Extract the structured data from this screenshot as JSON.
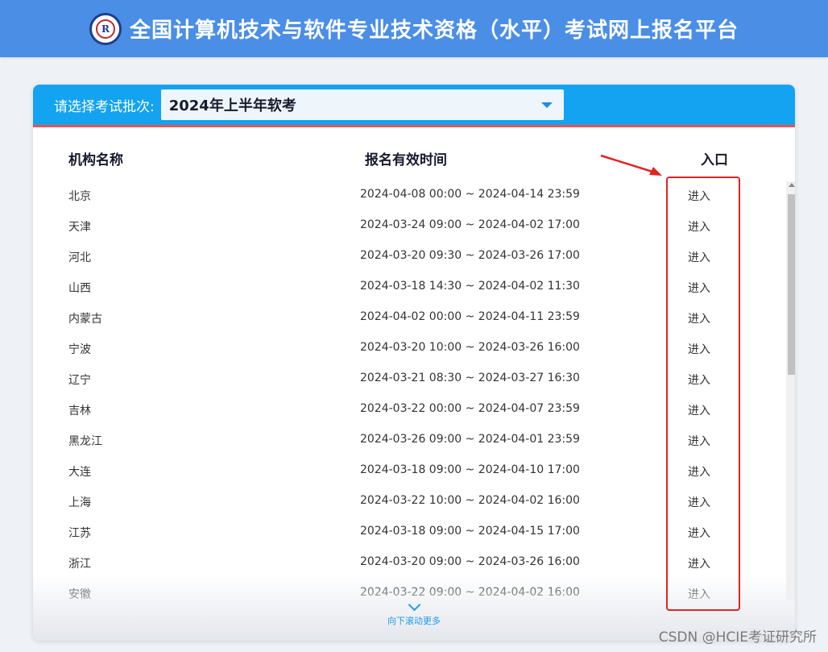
{
  "header": {
    "title": "全国计算机技术与软件专业技术资格（水平）考试网上报名平台",
    "logo_text": "R"
  },
  "batch": {
    "label": "请选择考试批次:",
    "value": "2024年上半年软考"
  },
  "table": {
    "columns": [
      "机构名称",
      "报名有效时间",
      "入口"
    ],
    "rows": [
      {
        "name": "北京",
        "time": "2024-04-08 00:00 ~ 2024-04-14 23:59",
        "entry": "进入"
      },
      {
        "name": "天津",
        "time": "2024-03-24 09:00 ~ 2024-04-02 17:00",
        "entry": "进入"
      },
      {
        "name": "河北",
        "time": "2024-03-20 09:30 ~ 2024-03-26 17:00",
        "entry": "进入"
      },
      {
        "name": "山西",
        "time": "2024-03-18 14:30 ~ 2024-04-02 11:30",
        "entry": "进入"
      },
      {
        "name": "内蒙古",
        "time": "2024-04-02 00:00 ~ 2024-04-11 23:59",
        "entry": "进入"
      },
      {
        "name": "宁波",
        "time": "2024-03-20 10:00 ~ 2024-03-26 16:00",
        "entry": "进入"
      },
      {
        "name": "辽宁",
        "time": "2024-03-21 08:30 ~ 2024-03-27 16:30",
        "entry": "进入"
      },
      {
        "name": "吉林",
        "time": "2024-03-22 00:00 ~ 2024-04-07 23:59",
        "entry": "进入"
      },
      {
        "name": "黑龙江",
        "time": "2024-03-26 09:00 ~ 2024-04-01 23:59",
        "entry": "进入"
      },
      {
        "name": "大连",
        "time": "2024-03-18 09:00 ~ 2024-04-10 17:00",
        "entry": "进入"
      },
      {
        "name": "上海",
        "time": "2024-03-22 10:00 ~ 2024-04-02 16:00",
        "entry": "进入"
      },
      {
        "name": "江苏",
        "time": "2024-03-18 09:00 ~ 2024-04-15 17:00",
        "entry": "进入"
      },
      {
        "name": "浙江",
        "time": "2024-03-20 09:00 ~ 2024-03-26 16:00",
        "entry": "进入"
      },
      {
        "name": "安徽",
        "time": "2024-03-22 09:00 ~ 2024-04-02 16:00",
        "entry": "进入"
      }
    ]
  },
  "scroll_more": {
    "label": "向下滚动更多",
    "icon": "chevron-down-icon"
  },
  "watermark": "CSDN @HCIE考证研究所",
  "colors": {
    "header": "#4a8ee6",
    "card_head": "#13a3f0",
    "accent_line": "#e9554f",
    "annotation": "#e02424",
    "link": "#1f9ce8"
  }
}
